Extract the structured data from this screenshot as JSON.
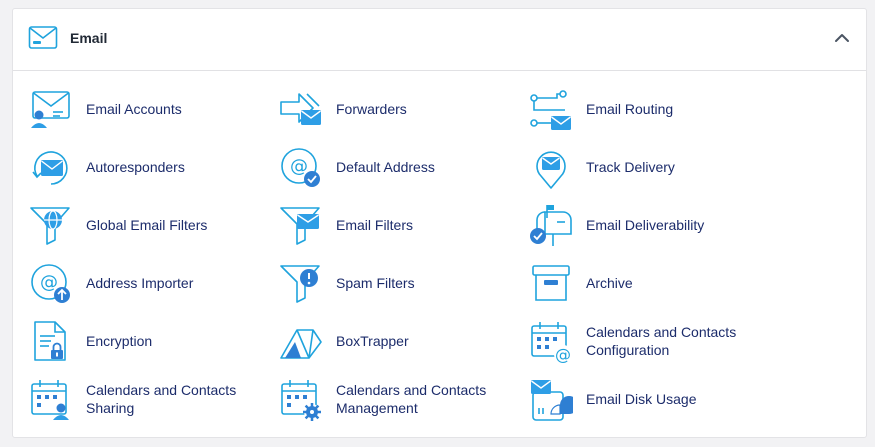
{
  "section": {
    "title": "Email",
    "icon": "envelope-icon",
    "collapse_icon": "chevron-up-icon"
  },
  "colors": {
    "icon_stroke": "#1fa3dd",
    "icon_fill": "#2e9ee6",
    "label": "#1c2c6b",
    "title": "#222a36"
  },
  "items": [
    {
      "label": "Email Accounts",
      "icon": "email-accounts-icon"
    },
    {
      "label": "Forwarders",
      "icon": "forwarders-icon"
    },
    {
      "label": "Email Routing",
      "icon": "email-routing-icon"
    },
    {
      "label": "Autoresponders",
      "icon": "autoresponders-icon"
    },
    {
      "label": "Default Address",
      "icon": "default-address-icon"
    },
    {
      "label": "Track Delivery",
      "icon": "track-delivery-icon"
    },
    {
      "label": "Global Email Filters",
      "icon": "global-email-filters-icon"
    },
    {
      "label": "Email Filters",
      "icon": "email-filters-icon"
    },
    {
      "label": "Email Deliverability",
      "icon": "email-deliverability-icon"
    },
    {
      "label": "Address Importer",
      "icon": "address-importer-icon"
    },
    {
      "label": "Spam Filters",
      "icon": "spam-filters-icon"
    },
    {
      "label": "Archive",
      "icon": "archive-icon"
    },
    {
      "label": "Encryption",
      "icon": "encryption-icon"
    },
    {
      "label": "BoxTrapper",
      "icon": "boxtrapper-icon"
    },
    {
      "label": "Calendars and Contacts Configuration",
      "icon": "calendars-contacts-configuration-icon"
    },
    {
      "label": "Calendars and Contacts Sharing",
      "icon": "calendars-contacts-sharing-icon"
    },
    {
      "label": "Calendars and Contacts Management",
      "icon": "calendars-contacts-management-icon"
    },
    {
      "label": "Email Disk Usage",
      "icon": "email-disk-usage-icon"
    }
  ]
}
